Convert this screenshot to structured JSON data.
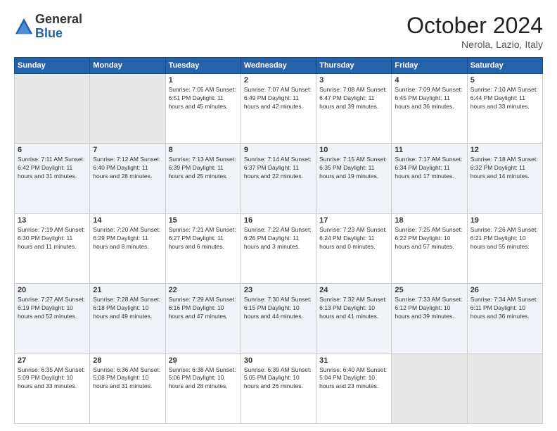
{
  "header": {
    "logo_general": "General",
    "logo_blue": "Blue",
    "month": "October 2024",
    "location": "Nerola, Lazio, Italy"
  },
  "days_of_week": [
    "Sunday",
    "Monday",
    "Tuesday",
    "Wednesday",
    "Thursday",
    "Friday",
    "Saturday"
  ],
  "weeks": [
    [
      {
        "day": "",
        "info": ""
      },
      {
        "day": "",
        "info": ""
      },
      {
        "day": "1",
        "info": "Sunrise: 7:05 AM\nSunset: 6:51 PM\nDaylight: 11 hours and 45 minutes."
      },
      {
        "day": "2",
        "info": "Sunrise: 7:07 AM\nSunset: 6:49 PM\nDaylight: 11 hours and 42 minutes."
      },
      {
        "day": "3",
        "info": "Sunrise: 7:08 AM\nSunset: 6:47 PM\nDaylight: 11 hours and 39 minutes."
      },
      {
        "day": "4",
        "info": "Sunrise: 7:09 AM\nSunset: 6:45 PM\nDaylight: 11 hours and 36 minutes."
      },
      {
        "day": "5",
        "info": "Sunrise: 7:10 AM\nSunset: 6:44 PM\nDaylight: 11 hours and 33 minutes."
      }
    ],
    [
      {
        "day": "6",
        "info": "Sunrise: 7:11 AM\nSunset: 6:42 PM\nDaylight: 11 hours and 31 minutes."
      },
      {
        "day": "7",
        "info": "Sunrise: 7:12 AM\nSunset: 6:40 PM\nDaylight: 11 hours and 28 minutes."
      },
      {
        "day": "8",
        "info": "Sunrise: 7:13 AM\nSunset: 6:39 PM\nDaylight: 11 hours and 25 minutes."
      },
      {
        "day": "9",
        "info": "Sunrise: 7:14 AM\nSunset: 6:37 PM\nDaylight: 11 hours and 22 minutes."
      },
      {
        "day": "10",
        "info": "Sunrise: 7:15 AM\nSunset: 6:35 PM\nDaylight: 11 hours and 19 minutes."
      },
      {
        "day": "11",
        "info": "Sunrise: 7:17 AM\nSunset: 6:34 PM\nDaylight: 11 hours and 17 minutes."
      },
      {
        "day": "12",
        "info": "Sunrise: 7:18 AM\nSunset: 6:32 PM\nDaylight: 11 hours and 14 minutes."
      }
    ],
    [
      {
        "day": "13",
        "info": "Sunrise: 7:19 AM\nSunset: 6:30 PM\nDaylight: 11 hours and 11 minutes."
      },
      {
        "day": "14",
        "info": "Sunrise: 7:20 AM\nSunset: 6:29 PM\nDaylight: 11 hours and 8 minutes."
      },
      {
        "day": "15",
        "info": "Sunrise: 7:21 AM\nSunset: 6:27 PM\nDaylight: 11 hours and 6 minutes."
      },
      {
        "day": "16",
        "info": "Sunrise: 7:22 AM\nSunset: 6:26 PM\nDaylight: 11 hours and 3 minutes."
      },
      {
        "day": "17",
        "info": "Sunrise: 7:23 AM\nSunset: 6:24 PM\nDaylight: 11 hours and 0 minutes."
      },
      {
        "day": "18",
        "info": "Sunrise: 7:25 AM\nSunset: 6:22 PM\nDaylight: 10 hours and 57 minutes."
      },
      {
        "day": "19",
        "info": "Sunrise: 7:26 AM\nSunset: 6:21 PM\nDaylight: 10 hours and 55 minutes."
      }
    ],
    [
      {
        "day": "20",
        "info": "Sunrise: 7:27 AM\nSunset: 6:19 PM\nDaylight: 10 hours and 52 minutes."
      },
      {
        "day": "21",
        "info": "Sunrise: 7:28 AM\nSunset: 6:18 PM\nDaylight: 10 hours and 49 minutes."
      },
      {
        "day": "22",
        "info": "Sunrise: 7:29 AM\nSunset: 6:16 PM\nDaylight: 10 hours and 47 minutes."
      },
      {
        "day": "23",
        "info": "Sunrise: 7:30 AM\nSunset: 6:15 PM\nDaylight: 10 hours and 44 minutes."
      },
      {
        "day": "24",
        "info": "Sunrise: 7:32 AM\nSunset: 6:13 PM\nDaylight: 10 hours and 41 minutes."
      },
      {
        "day": "25",
        "info": "Sunrise: 7:33 AM\nSunset: 6:12 PM\nDaylight: 10 hours and 39 minutes."
      },
      {
        "day": "26",
        "info": "Sunrise: 7:34 AM\nSunset: 6:11 PM\nDaylight: 10 hours and 36 minutes."
      }
    ],
    [
      {
        "day": "27",
        "info": "Sunrise: 6:35 AM\nSunset: 5:09 PM\nDaylight: 10 hours and 33 minutes."
      },
      {
        "day": "28",
        "info": "Sunrise: 6:36 AM\nSunset: 5:08 PM\nDaylight: 10 hours and 31 minutes."
      },
      {
        "day": "29",
        "info": "Sunrise: 6:38 AM\nSunset: 5:06 PM\nDaylight: 10 hours and 28 minutes."
      },
      {
        "day": "30",
        "info": "Sunrise: 6:39 AM\nSunset: 5:05 PM\nDaylight: 10 hours and 26 minutes."
      },
      {
        "day": "31",
        "info": "Sunrise: 6:40 AM\nSunset: 5:04 PM\nDaylight: 10 hours and 23 minutes."
      },
      {
        "day": "",
        "info": ""
      },
      {
        "day": "",
        "info": ""
      }
    ]
  ]
}
